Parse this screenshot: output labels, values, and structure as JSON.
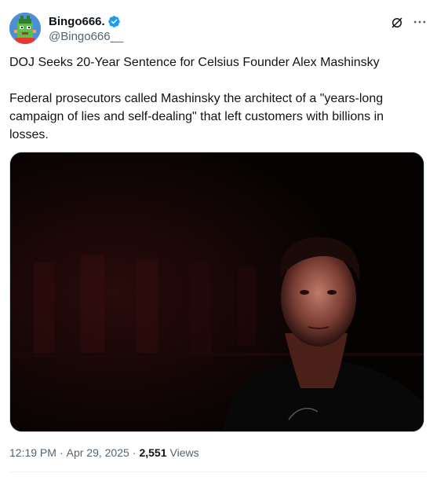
{
  "author": {
    "display_name": "Bingo666.",
    "handle": "@Bingo666__",
    "verified": true,
    "avatar_icon": "pixel-avatar"
  },
  "tweet": {
    "line1": "DOJ Seeks 20-Year Sentence for Celsius Founder Alex Mashinsky",
    "line2": "Federal prosecutors called Mashinsky the architect of a \"years-long campaign of lies and self-dealing\" that left customers with billions in losses."
  },
  "meta": {
    "time": "12:19 PM",
    "separator": "·",
    "date": "Apr 29, 2025",
    "views_count": "2,551",
    "views_label": "Views"
  },
  "colors": {
    "verified_blue": "#1d9bf0",
    "text_primary": "#0f1419",
    "text_secondary": "#536471"
  },
  "icons": {
    "grok": "grok-icon",
    "more": "more-icon",
    "verified": "verified-badge-icon"
  }
}
